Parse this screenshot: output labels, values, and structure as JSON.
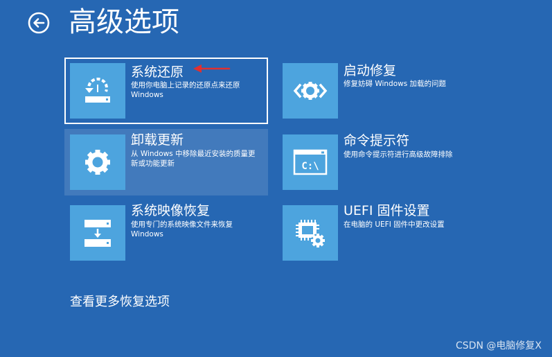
{
  "header": {
    "title": "高级选项",
    "back_icon": "back-arrow-circle-icon"
  },
  "options": [
    {
      "title": "系统还原",
      "description": "使用你电脑上记录的还原点来还原 Windows",
      "icon": "system-restore-icon",
      "state": "selected"
    },
    {
      "title": "启动修复",
      "description": "修复妨碍 Windows 加载的问题",
      "icon": "startup-repair-icon"
    },
    {
      "title": "卸载更新",
      "description": "从 Windows 中移除最近安装的质量更新或功能更新",
      "icon": "gear-icon",
      "state": "hover"
    },
    {
      "title": "命令提示符",
      "description": "使用命令提示符进行高级故障排除",
      "icon": "command-prompt-icon",
      "icon_text": "C:\\"
    },
    {
      "title": "系统映像恢复",
      "description": "使用专门的系统映像文件来恢复 Windows",
      "icon": "system-image-recovery-icon"
    },
    {
      "title": "UEFI 固件设置",
      "description": "在电脑的 UEFI 固件中更改设置",
      "icon": "uefi-firmware-settings-icon"
    }
  ],
  "more_options_link": "查看更多恢复选项",
  "watermark": "CSDN @电脑修复X",
  "colors": {
    "background": "#2667b3",
    "tile_icon": "#4da4de",
    "annotation_arrow": "#e03030"
  }
}
